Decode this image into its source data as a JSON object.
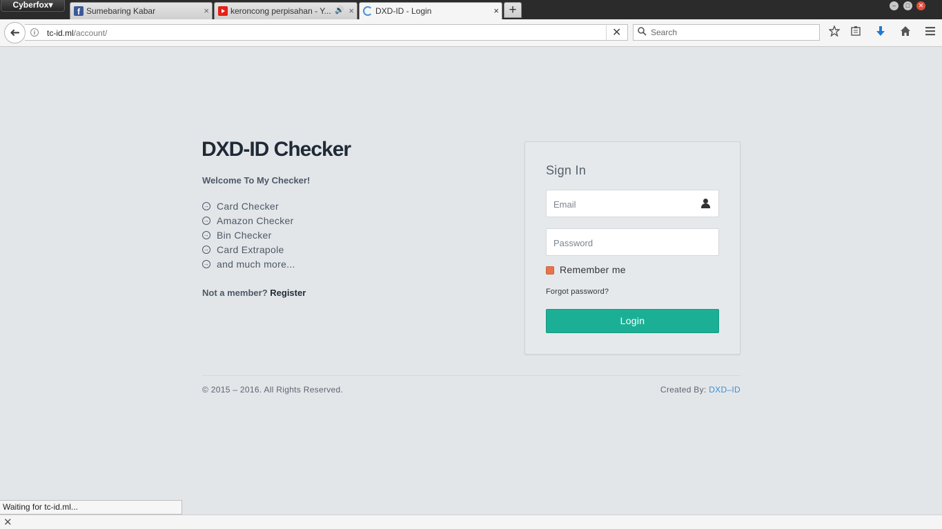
{
  "browser": {
    "menu_label": "Cyberfox▾",
    "tabs": [
      {
        "title": "Sumebaring Kabar",
        "favicon": "facebook-icon",
        "favicon_text": "f"
      },
      {
        "title": "keroncong perpisahan - Y...",
        "favicon": "youtube-icon",
        "audio": "🔊"
      },
      {
        "title": "DXD-ID - Login",
        "favicon": "loading-spinner-icon"
      }
    ],
    "tab_close": "×",
    "new_tab": "+",
    "url_host": "tc-id.ml",
    "url_path": "/account/",
    "stop": "✕",
    "search_placeholder": "Search",
    "status_text": "Waiting for tc-id.ml...",
    "info_glyph": "i",
    "back_glyph": "➜",
    "window_buttons": [
      "–",
      "□",
      "✕"
    ]
  },
  "page": {
    "brand": "DXD-ID Checker",
    "welcome": "Welcome To My Checker!",
    "features": [
      "Card Checker",
      "Amazon Checker",
      "Bin Checker",
      "Card Extrapole",
      "and much more..."
    ],
    "feature_bullet": "→",
    "member_text": "Not a member?",
    "register": "Register",
    "signin_title": "Sign In",
    "email_placeholder": "Email",
    "password_placeholder": "Password",
    "remember": "Remember me",
    "forgot": "Forgot password?",
    "login": "Login",
    "copyright": "© 2015 – 2016. All Rights Reserved.",
    "created_by": "Created By:",
    "author": "DXD–ID"
  },
  "colors": {
    "accent": "#1bb096",
    "checkbox": "#e8734b",
    "link": "#3a8fd3"
  }
}
